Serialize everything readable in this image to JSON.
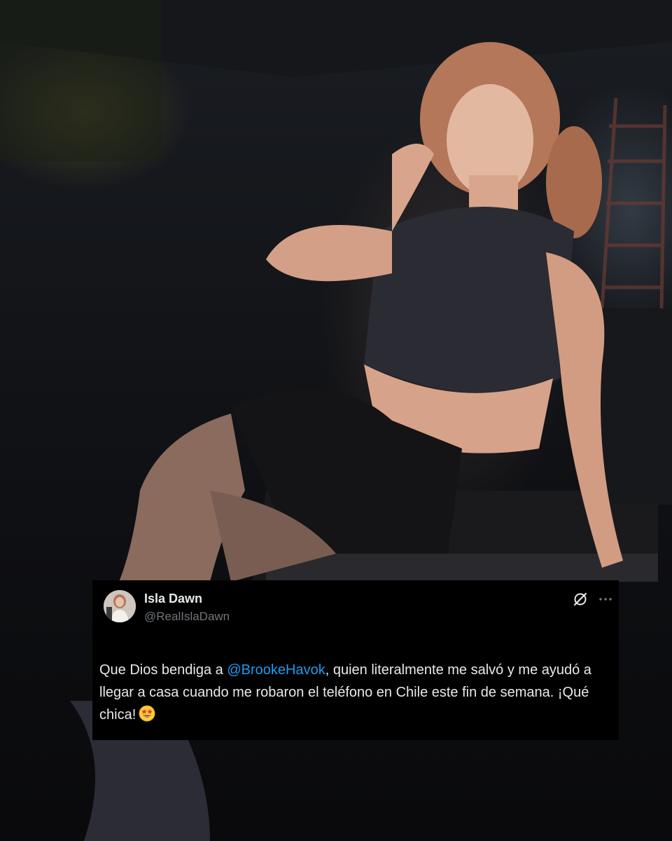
{
  "tweet": {
    "display_name": "Isla Dawn",
    "handle": "@RealIslaDawn",
    "text_before": "Que Dios bendiga a ",
    "mention": "@BrookeHavok",
    "text_after": ", quien literalmente me salvó y me ayudó a llegar a casa cuando me robaron el teléfono en Chile este fin de semana. ¡Qué chica!",
    "emoji": "star-struck-emoji",
    "icons": {
      "grok": "grok-icon",
      "more": "more-icon"
    }
  },
  "colors": {
    "card_background": "#000000",
    "text": "#e7e9ea",
    "secondary_text": "#71767b",
    "link": "#1d9bf0"
  }
}
